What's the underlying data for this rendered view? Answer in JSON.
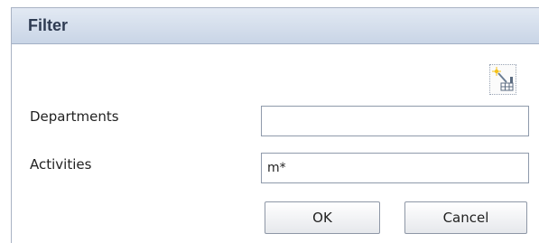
{
  "dialog": {
    "title": "Filter"
  },
  "toolbar": {
    "clear_icon": "clear-filter-icon"
  },
  "fields": {
    "departments": {
      "label": "Departments",
      "value": ""
    },
    "activities": {
      "label": "Activities",
      "value": "m*"
    }
  },
  "buttons": {
    "ok": "OK",
    "cancel": "Cancel"
  }
}
